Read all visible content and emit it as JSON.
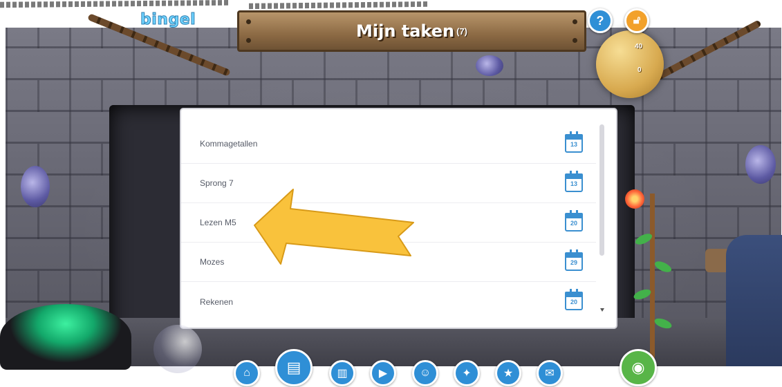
{
  "app": {
    "logo": "bingel"
  },
  "header": {
    "title": "Mijn taken",
    "count": "(7)"
  },
  "score": {
    "coins": "40",
    "stars": "0"
  },
  "tasks": [
    {
      "label": "Kommagetallen",
      "due_day": "13"
    },
    {
      "label": "Sprong 7",
      "due_day": "13"
    },
    {
      "label": "Lezen M5",
      "due_day": "20"
    },
    {
      "label": "Mozes",
      "due_day": "29"
    },
    {
      "label": "Rekenen",
      "due_day": "20"
    }
  ],
  "nav": [
    {
      "icon": "home-icon",
      "glyph": "⌂"
    },
    {
      "icon": "tasks-icon",
      "glyph": "▤"
    },
    {
      "icon": "book-icon",
      "glyph": "▥"
    },
    {
      "icon": "video-icon",
      "glyph": "▶"
    },
    {
      "icon": "profile-icon",
      "glyph": "☺"
    },
    {
      "icon": "games-icon",
      "glyph": "✦"
    },
    {
      "icon": "star-icon",
      "glyph": "★"
    },
    {
      "icon": "chat-icon",
      "glyph": "✉"
    }
  ],
  "colors": {
    "accent": "#2f8fd6",
    "lock": "#f2a12b",
    "arrow": "#f9c23c",
    "green": "#58b548"
  }
}
